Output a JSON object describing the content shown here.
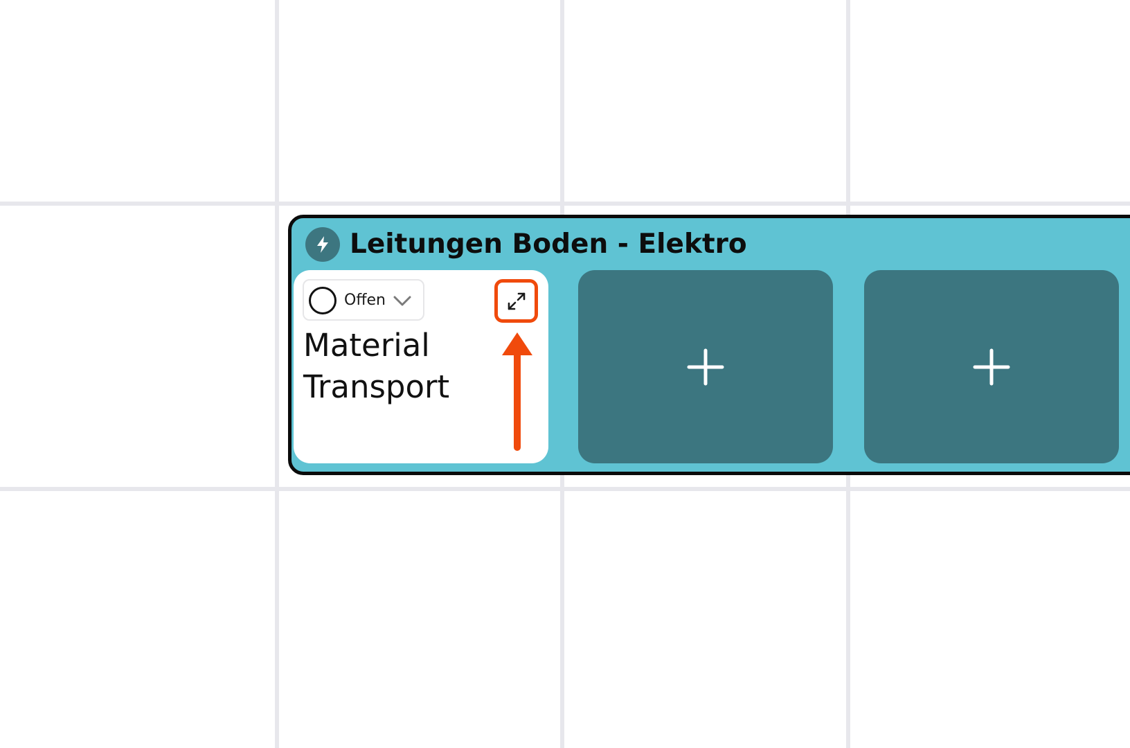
{
  "group": {
    "title": "Leitungen Boden - Elektro",
    "icon": "lightning-bolt-icon"
  },
  "task_card": {
    "status_label": "Offen",
    "title": "Material Transport",
    "status_icon": "circle-outline-icon",
    "expand_icon": "expand-arrows-icon"
  },
  "add_cards": [
    {
      "icon": "plus-icon"
    },
    {
      "icon": "plus-icon"
    }
  ],
  "colors": {
    "group_background": "#5fc3d3",
    "group_border": "#0b0b0b",
    "add_card_background": "#3c7680",
    "highlight": "#f04a0c",
    "grid_line": "#e7e7ec"
  }
}
